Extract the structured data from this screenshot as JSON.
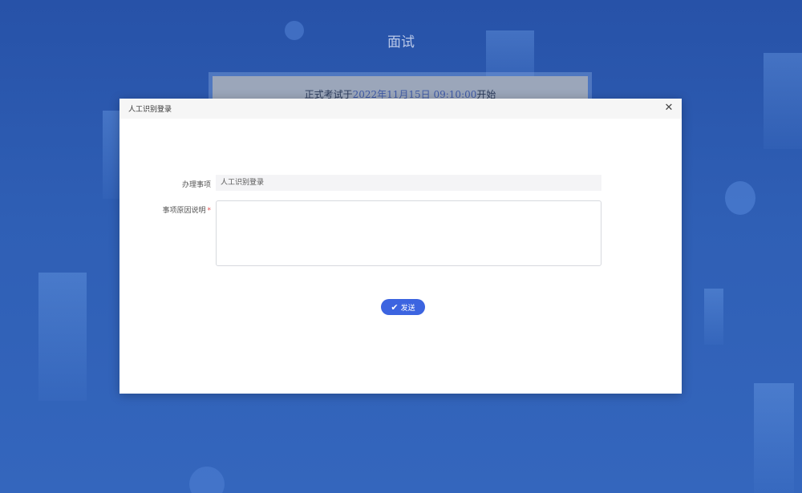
{
  "page": {
    "title": "面试",
    "notice": {
      "prefix": "正式考试于",
      "datetime": "2022年11月15日 09:10:00",
      "suffix": "开始"
    }
  },
  "modal": {
    "title": "人工识别登录",
    "close_icon": "close-icon",
    "fields": {
      "matter_label": "办理事项",
      "matter_value": "人工识别登录",
      "reason_label": "事项原因说明",
      "reason_required_mark": "*",
      "reason_value": ""
    },
    "send_button": {
      "label": "发送",
      "icon": "check-icon"
    }
  },
  "colors": {
    "background": "#2f5fb5",
    "accent": "#3c64e0",
    "required": "#e24c4c"
  }
}
